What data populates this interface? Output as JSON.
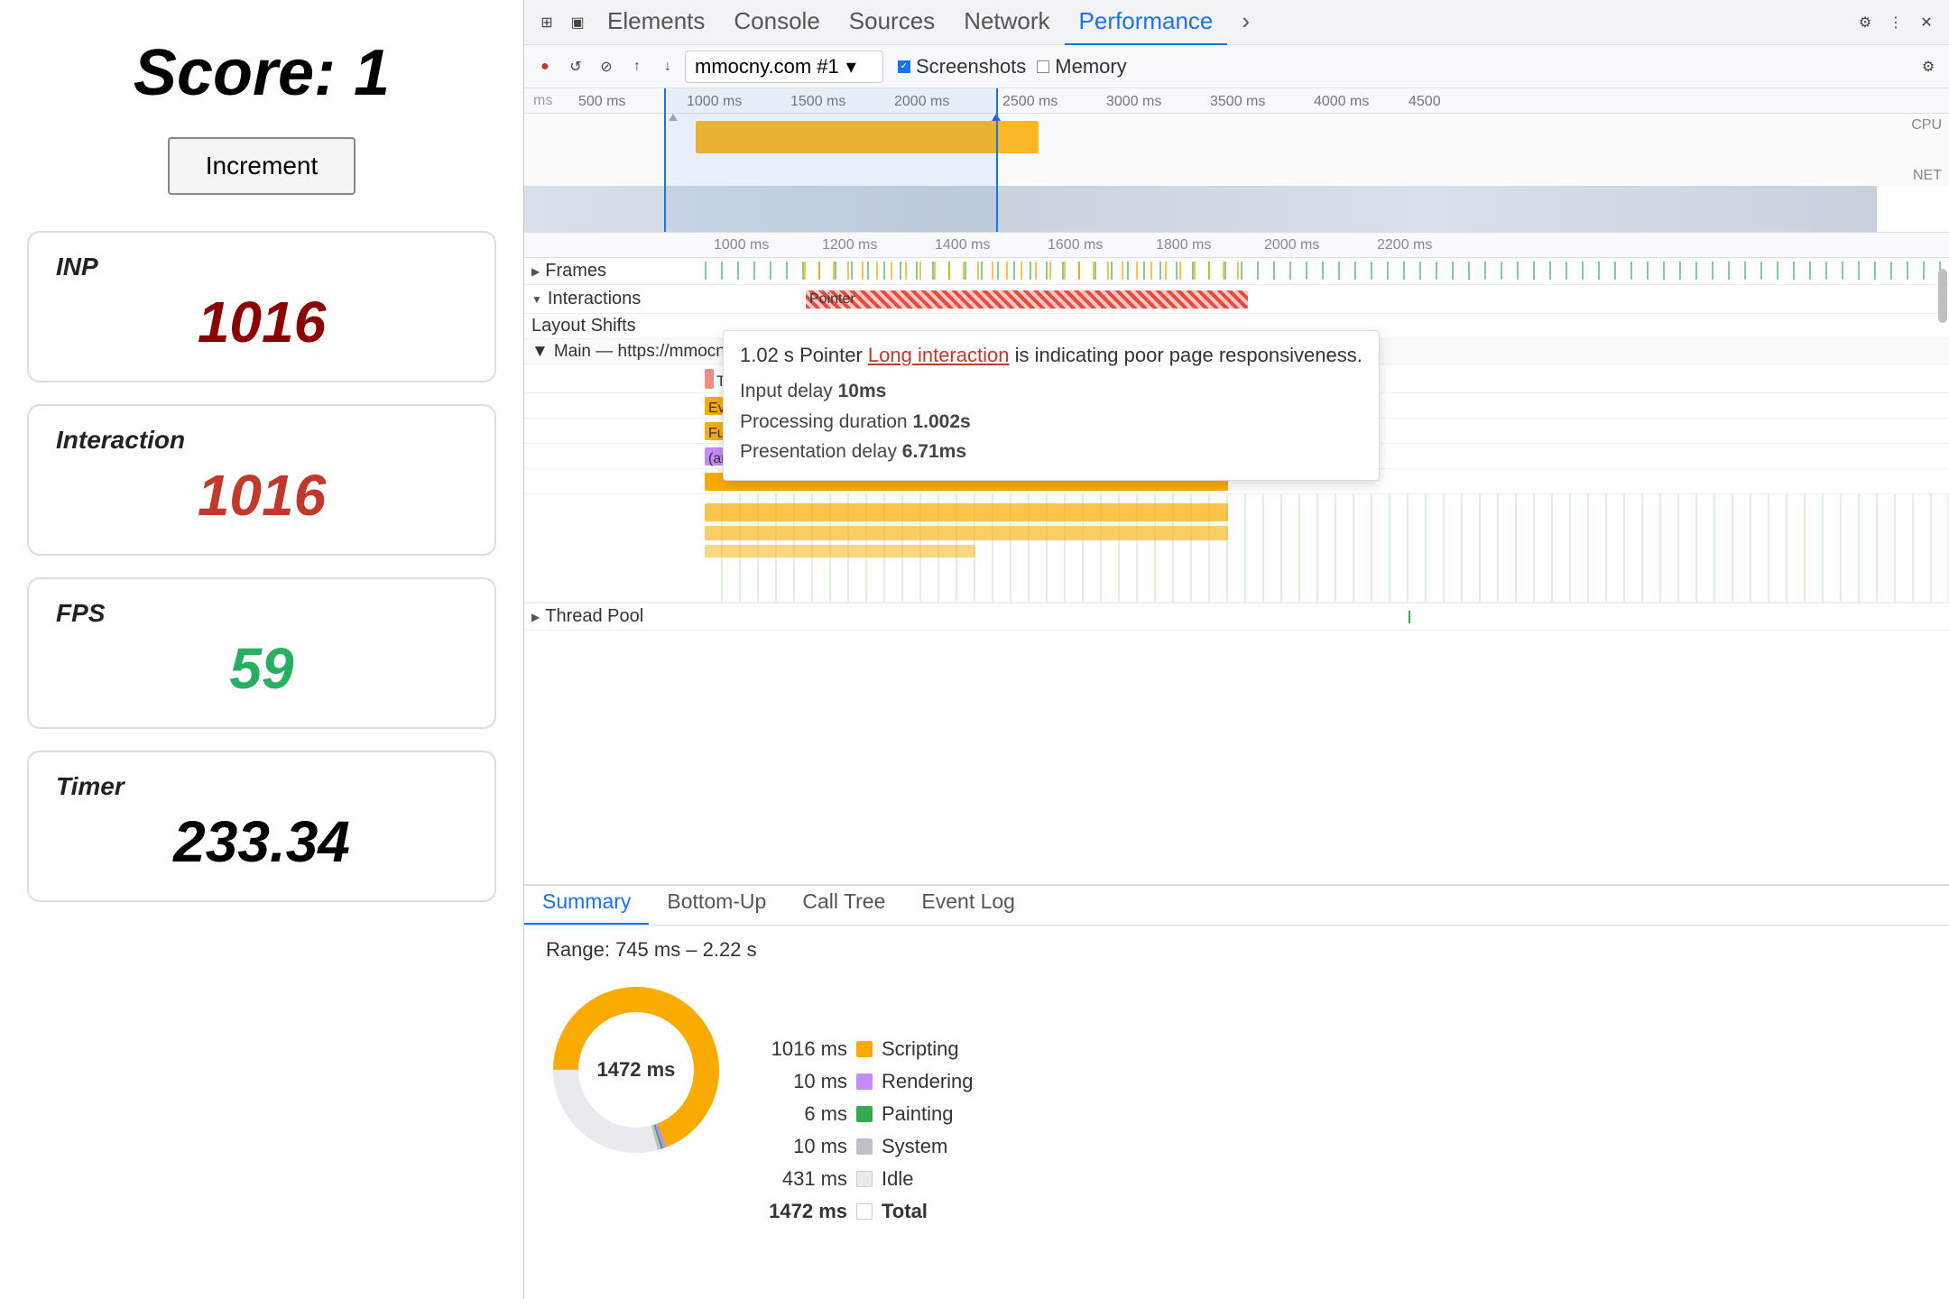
{
  "left": {
    "score_label": "Score:",
    "score_value": "1",
    "increment_btn": "Increment",
    "metrics": [
      {
        "label": "INP",
        "value": "1016",
        "color": "dark-red"
      },
      {
        "label": "Interaction",
        "value": "1016",
        "color": "dark-red"
      },
      {
        "label": "FPS",
        "value": "59",
        "color": "green"
      },
      {
        "label": "Timer",
        "value": "233.34",
        "color": "black"
      }
    ]
  },
  "devtools": {
    "tabs": [
      "Elements",
      "Console",
      "Sources",
      "Network",
      "Performance",
      "›"
    ],
    "active_tab": "Performance",
    "toolbar": {
      "url": "mmocny.com #1",
      "screenshots_checked": true,
      "memory_checked": false
    },
    "ruler_ticks_top": [
      "500 ms",
      "1000 ms",
      "1500 ms",
      "2000 ms",
      "2500 ms",
      "3000 ms",
      "3500 ms",
      "4000 ms",
      "4500"
    ],
    "ruler_ticks_main": [
      "1000 ms",
      "1200 ms",
      "1400 ms",
      "1600 ms",
      "1800 ms",
      "2000 ms",
      "2200 ms"
    ],
    "tracks": {
      "frames_label": "Frames",
      "interactions_label": "Interactions",
      "interaction_bar_label": "Pointer",
      "layout_shifts_label": "Layout Shifts",
      "main_thread_label": "Main — https://mmocny.co",
      "thread_pool_label": "Thread Pool"
    },
    "tooltip": {
      "time": "1.02 s",
      "event": "Pointer",
      "link_text": "Long interaction",
      "suffix": "is indicating poor page responsiveness.",
      "input_delay": "10ms",
      "processing_duration": "1.002s",
      "presentation_delay": "6.71ms"
    },
    "task_bars": [
      {
        "label": "Task",
        "color": "#f28b82"
      },
      {
        "label": "Event: click",
        "color": "#f9ab00"
      },
      {
        "label": "Function Call",
        "color": "#f9ab00"
      },
      {
        "label": "(anonymous)",
        "color": "#c58af9"
      }
    ],
    "summary": {
      "tabs": [
        "Summary",
        "Bottom-Up",
        "Call Tree",
        "Event Log"
      ],
      "active_tab": "Summary",
      "range": "Range: 745 ms – 2.22 s",
      "center_label": "1472 ms",
      "legend": [
        {
          "ms": "1016 ms",
          "color": "#f9ab00",
          "name": "Scripting"
        },
        {
          "ms": "10 ms",
          "color": "#c58af9",
          "name": "Rendering"
        },
        {
          "ms": "6 ms",
          "color": "#34a853",
          "name": "Painting"
        },
        {
          "ms": "10 ms",
          "color": "#bdc1c6",
          "name": "System"
        },
        {
          "ms": "431 ms",
          "color": "#e8eaed",
          "name": "Idle"
        },
        {
          "ms": "1472 ms",
          "color": "#fff",
          "name": "Total"
        }
      ]
    }
  }
}
